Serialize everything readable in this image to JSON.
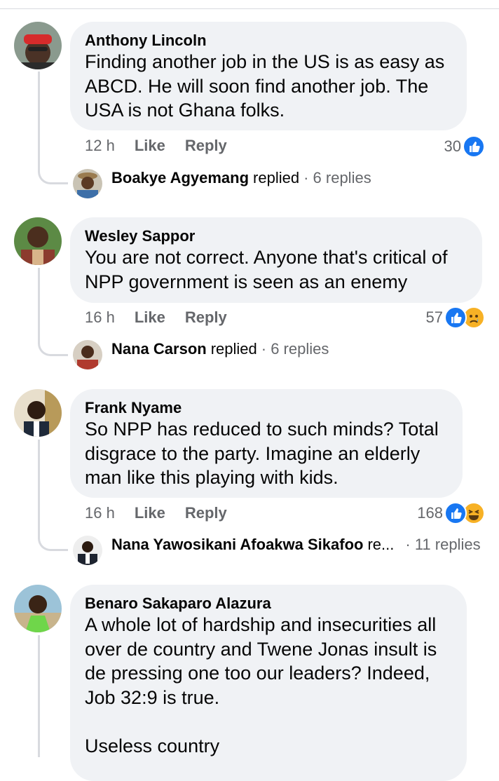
{
  "comments": [
    {
      "author": "Anthony Lincoln",
      "text": "Finding another job in the US is as easy as ABCD. He will soon find another job. The USA is not Ghana folks.",
      "time": "12 h",
      "like_label": "Like",
      "reply_label": "Reply",
      "reaction_count": "30",
      "reactions": [
        "like-icon"
      ],
      "reply_thread": {
        "name": "Boakye Agyemang",
        "action": "replied",
        "count": "· 6 replies"
      }
    },
    {
      "author": "Wesley Sappor",
      "text": "You are not correct. Anyone that's critical of NPP government is seen as an enemy",
      "time": "16 h",
      "like_label": "Like",
      "reply_label": "Reply",
      "reaction_count": "57",
      "reactions": [
        "like-icon",
        "sad-icon"
      ],
      "reply_thread": {
        "name": "Nana Carson",
        "action": "replied",
        "count": "· 6 replies"
      }
    },
    {
      "author": "Frank Nyame",
      "text": "So NPP has reduced to such minds? Total disgrace to the party. Imagine an elderly man like this playing with kids.",
      "time": "16 h",
      "like_label": "Like",
      "reply_label": "Reply",
      "reaction_count": "168",
      "reactions": [
        "like-icon",
        "haha-icon"
      ],
      "reply_thread": {
        "name": "Nana Yawosikani Afoakwa Sikafoo",
        "action": "re...",
        "count": "· 11 replies"
      }
    },
    {
      "author": "Benaro Sakaparo Alazura",
      "text": "A whole lot of hardship and insecurities all over de country and Twene Jonas insult is de pressing one too our leaders? Indeed, Job 32:9 is true.\n\nUseless country"
    }
  ],
  "colors": {
    "bubble": "#f0f2f5",
    "secondary_text": "#65676b",
    "like_blue": "#1877f2",
    "emoji_yellow": "#f7b125"
  }
}
